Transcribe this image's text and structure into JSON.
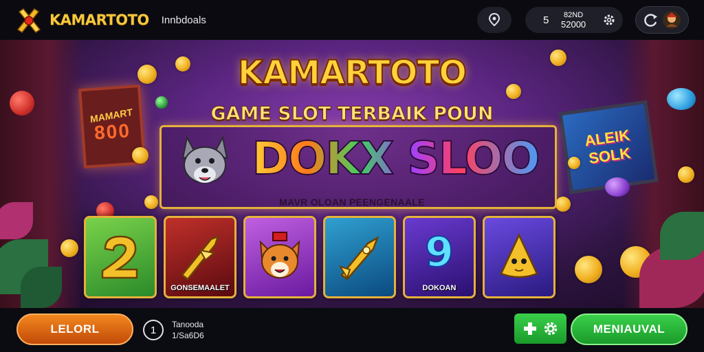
{
  "header": {
    "brand_name": "KAMARTOTO",
    "nav_link": "Innbdoals",
    "wallet": {
      "count": "5",
      "line1": "82ND",
      "line2": "52000"
    }
  },
  "hero": {
    "title": "KAMARTOTO",
    "subtitle": "GAME SLOT TERBAIK POUN",
    "logo_word": "DOKX SLOO",
    "caption": "MAVR OLOAN PEENGENAALE",
    "sign_left": {
      "line1": "MAMART",
      "line2": "800"
    },
    "sign_right": {
      "line1": "ALEIK",
      "line2": "SOLK"
    }
  },
  "games": [
    {
      "icon": "golden-number-2-icon",
      "label": ""
    },
    {
      "icon": "golden-arrow-icon",
      "label": "GONSEMAALET"
    },
    {
      "icon": "fox-mascot-icon",
      "label": ""
    },
    {
      "icon": "golden-rocket-icon",
      "label": ""
    },
    {
      "icon": "number-9-icon",
      "label": "DOKOAN",
      "number": "9"
    },
    {
      "icon": "golden-creature-icon",
      "label": ""
    }
  ],
  "footer": {
    "left_button": "LELORL",
    "info_icon": "1",
    "info_line1": "Tanooda",
    "info_line2": "1/Sa6D6",
    "right_button": "MENIAUVAL"
  },
  "colors": {
    "gold": "#f6c73b",
    "orange_button": "#e0701a",
    "green_button": "#2ab83a",
    "stage_purple": "#5a2580"
  }
}
